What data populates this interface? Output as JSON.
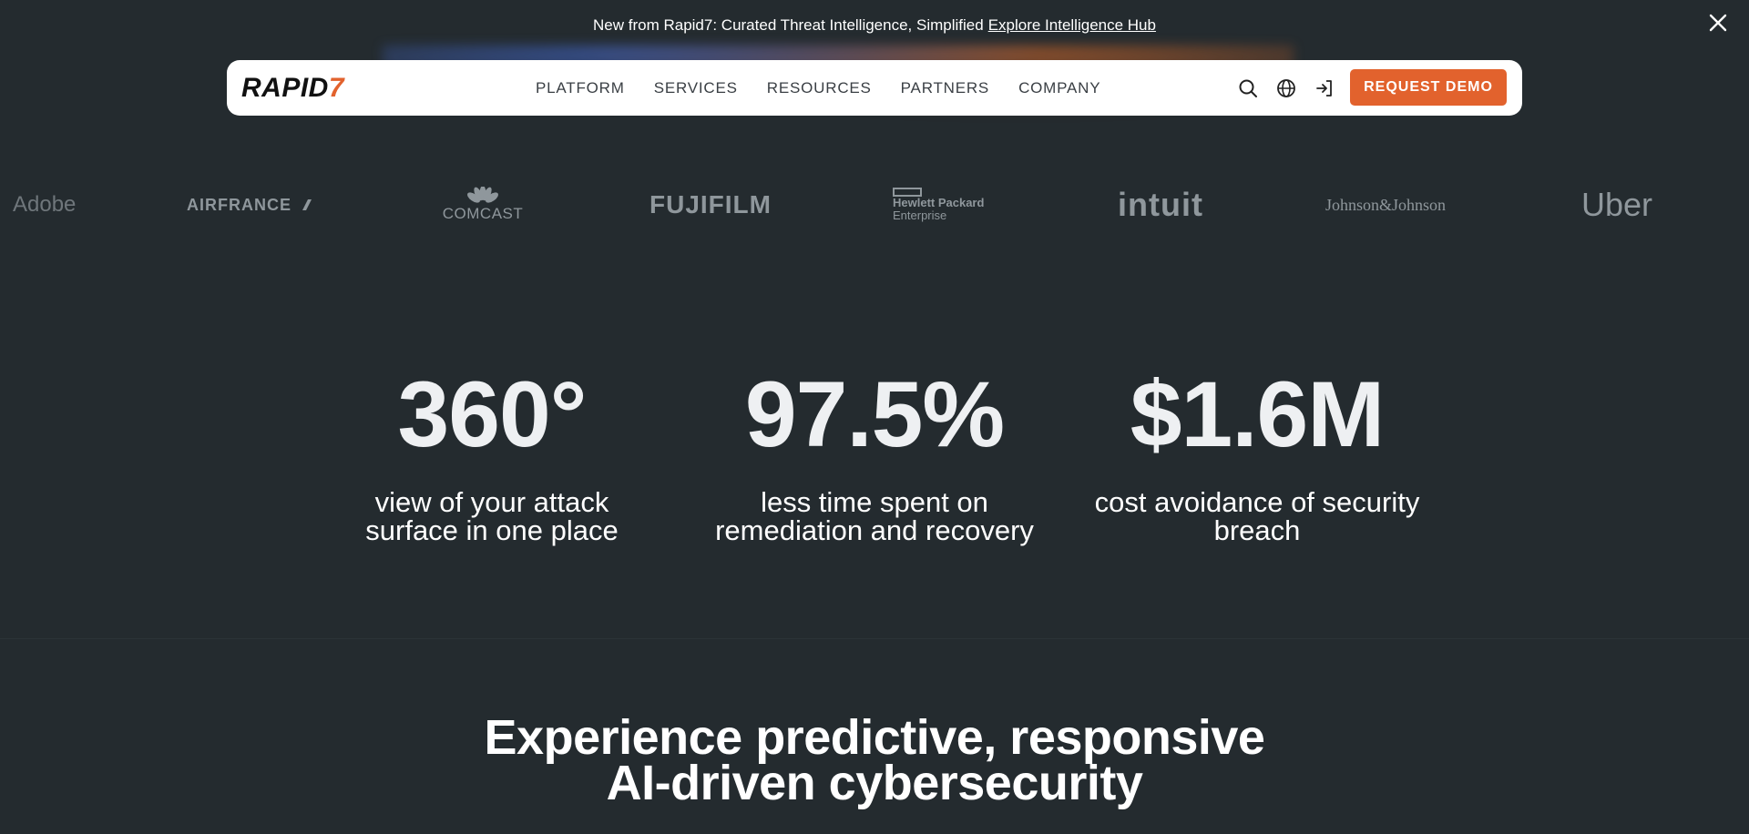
{
  "announcement": {
    "text": "New from Rapid7: Curated Threat Intelligence, Simplified",
    "link_text": "Explore Intelligence Hub"
  },
  "nav": {
    "logo_main": "RAPID",
    "logo_seven": "7",
    "menu": [
      "PLATFORM",
      "SERVICES",
      "RESOURCES",
      "PARTNERS",
      "COMPANY"
    ],
    "icons": [
      "search-icon",
      "globe-icon",
      "sign-in-icon"
    ],
    "cta_label": "REQUEST DEMO",
    "accent_color": "#e2622d"
  },
  "customer_logos": {
    "adobe": "Adobe",
    "airfrance": "AIRFRANCE",
    "comcast": "COMCAST",
    "fujifilm": "FUJIFILM",
    "hpe_line1": "Hewlett Packard",
    "hpe_line2": "Enterprise",
    "intuit": "intuit",
    "jnj": "Johnson&Johnson",
    "uber": "Uber"
  },
  "stats": [
    {
      "value": "360°",
      "caption_line1": "view of your attack",
      "caption_line2": "surface in one place"
    },
    {
      "value": "97.5%",
      "caption_line1": "less time spent on",
      "caption_line2": "remediation and recovery"
    },
    {
      "value": "$1.6M",
      "caption_line1": "cost avoidance of security",
      "caption_line2": "breach"
    }
  ],
  "headline": {
    "line1": "Experience predictive, responsive",
    "line2": "AI-driven cybersecurity"
  },
  "colors": {
    "background": "#242b2f",
    "logo_gray": "#8f979c"
  }
}
